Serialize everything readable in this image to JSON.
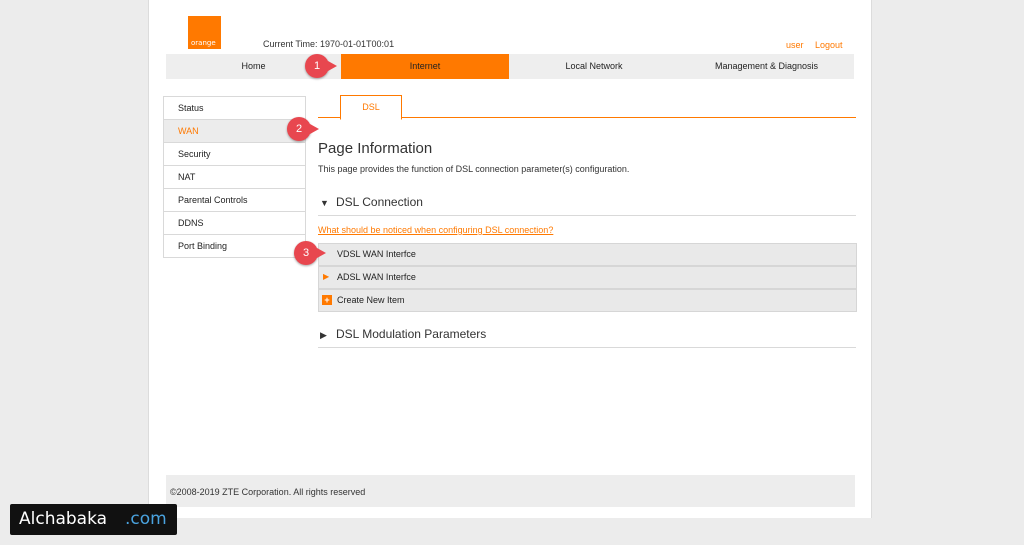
{
  "header": {
    "logo_text": "orange",
    "current_time": "Current Time: 1970-01-01T00:01",
    "user_label": "user",
    "logout_label": "Logout"
  },
  "nav": {
    "tabs": [
      {
        "label": "Home"
      },
      {
        "label": "Internet",
        "active": true
      },
      {
        "label": "Local Network"
      },
      {
        "label": "Management & Diagnosis"
      }
    ]
  },
  "sidebar": {
    "items": [
      {
        "label": "Status"
      },
      {
        "label": "WAN",
        "active": true
      },
      {
        "label": "Security"
      },
      {
        "label": "NAT"
      },
      {
        "label": "Parental Controls"
      },
      {
        "label": "DDNS"
      },
      {
        "label": "Port Binding"
      }
    ]
  },
  "content": {
    "tab_label": "DSL",
    "page_title": "Page Information",
    "page_description": "This page provides the function of DSL connection parameter(s) configuration.",
    "dsl_connection": {
      "title": "DSL Connection",
      "help_link": "What should be noticed when configuring DSL connection?",
      "rows": [
        {
          "label": "VDSL WAN Interfce"
        },
        {
          "label": "ADSL WAN Interfce"
        }
      ],
      "create_label": "Create New Item"
    },
    "modulation": {
      "title": "DSL Modulation Parameters"
    }
  },
  "callouts": [
    "1",
    "2",
    "3"
  ],
  "footer": {
    "copyright": "©2008-2019 ZTE Corporation. All rights reserved"
  },
  "watermark": {
    "part1": "Alchabaka",
    "part2": ".com"
  },
  "colors": {
    "accent": "#ff7900",
    "callout": "#e8474f"
  },
  "icons": {
    "section_expanded": "triangle-down-icon",
    "section_collapsed": "triangle-right-icon",
    "create": "plus-icon"
  }
}
